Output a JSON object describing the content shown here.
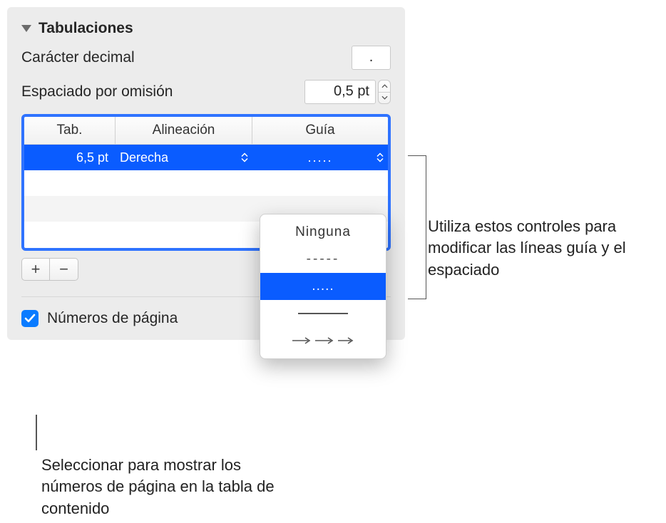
{
  "section": {
    "title": "Tabulaciones"
  },
  "decimal": {
    "label": "Carácter decimal",
    "value": "."
  },
  "spacing": {
    "label": "Espaciado por omisión",
    "value": "0,5 pt"
  },
  "table": {
    "headers": {
      "tab": "Tab.",
      "align": "Alineación",
      "guide": "Guía"
    },
    "row": {
      "tab": "6,5 pt",
      "align": "Derecha",
      "guide": "....."
    }
  },
  "buttons": {
    "add": "+",
    "remove": "−"
  },
  "pagenum": {
    "label": "Números de página",
    "checked": true
  },
  "popup": {
    "none": "Ninguna",
    "dashes": "-----",
    "dots": "....."
  },
  "callouts": {
    "right": "Utiliza estos controles para modificar las líneas guía y el espaciado",
    "bottom": "Seleccionar para mostrar los números de página en la tabla de contenido"
  }
}
